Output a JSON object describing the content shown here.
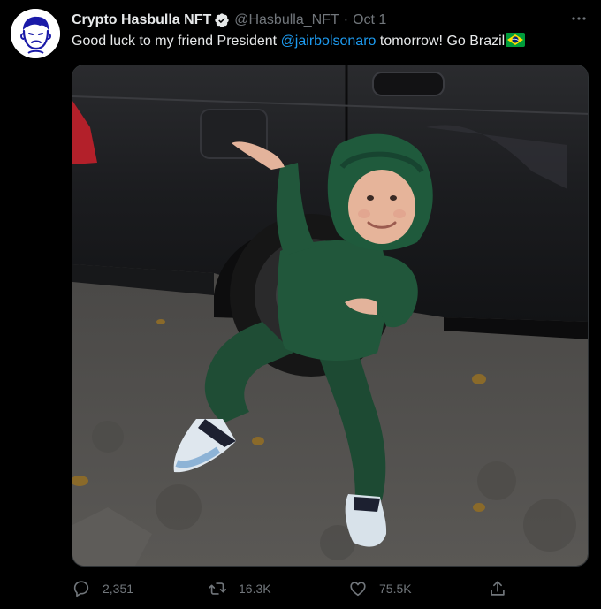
{
  "tweet": {
    "display_name": "Crypto Hasbulla NFT",
    "handle": "@Hasbulla_NFT",
    "separator": "·",
    "date": "Oct 1",
    "text_before": "Good luck to my friend President ",
    "mention": "@jairbolsonaro",
    "text_after": " tomorrow! Go Brazil",
    "flag_icon": "brazil-flag-icon",
    "media_alt": "Photo of a child in a green hooded tracksuit posing beside a dark car"
  },
  "actions": {
    "reply_count": "2,351",
    "retweet_count": "16.3K",
    "like_count": "75.5K"
  },
  "colors": {
    "background": "#000000",
    "text": "#e7e9ea",
    "secondary": "#71767b",
    "accent": "#1d9bf0",
    "avatar_stroke": "#1a1aa8"
  }
}
